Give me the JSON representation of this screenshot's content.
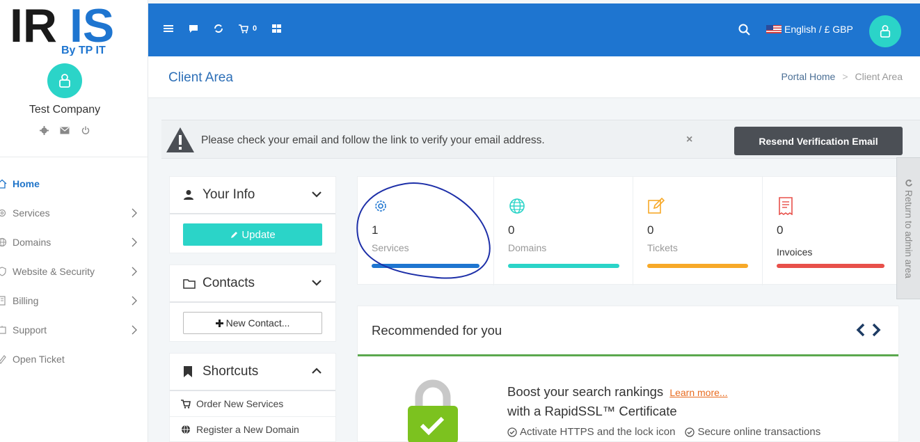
{
  "brand": {
    "logo_text": "IRIS",
    "logo_sub": "By TP IT"
  },
  "user": {
    "company": "Test Company"
  },
  "sidebar": {
    "items": [
      {
        "label": "Home",
        "icon": "home-icon",
        "active": true
      },
      {
        "label": "Services",
        "icon": "gear-icon"
      },
      {
        "label": "Domains",
        "icon": "globe-icon"
      },
      {
        "label": "Website & Security",
        "icon": "shield-icon"
      },
      {
        "label": "Billing",
        "icon": "billing-icon"
      },
      {
        "label": "Support",
        "icon": "support-icon"
      },
      {
        "label": "Open Ticket",
        "icon": "ticket-icon"
      }
    ]
  },
  "topbar": {
    "cart_count": "0",
    "language": "English / £ GBP"
  },
  "header": {
    "title": "Client Area",
    "breadcrumb": [
      "Portal Home",
      "Client Area"
    ]
  },
  "alert": {
    "message": "Please check your email and follow the link to verify your email address.",
    "close": "×",
    "button": "Resend Verification Email"
  },
  "panels": {
    "info": {
      "title": "Your Info",
      "button": "Update"
    },
    "contacts": {
      "title": "Contacts",
      "button": "New Contact..."
    },
    "shortcuts": {
      "title": "Shortcuts",
      "items": [
        "Order New Services",
        "Register a New Domain"
      ]
    }
  },
  "stats": [
    {
      "count": "1",
      "label": "Services",
      "color": "#1e75d0"
    },
    {
      "count": "0",
      "label": "Domains",
      "color": "#2bd4c8"
    },
    {
      "count": "0",
      "label": "Tickets",
      "color": "#f7a928"
    },
    {
      "count": "0",
      "label": "Invoices",
      "color": "#e8504a"
    }
  ],
  "recommended": {
    "title": "Recommended for you",
    "line1": "Boost your search rankings",
    "link": "Learn more...",
    "line2": "with a RapidSSL™ Certificate",
    "features": [
      "Activate HTTPS and the lock icon",
      "Secure online transactions"
    ]
  },
  "return_admin": "Return to admin area",
  "colors": {
    "primary": "#1e75d0",
    "accent": "#2bd4c8",
    "dark_button": "#4b4f55"
  }
}
